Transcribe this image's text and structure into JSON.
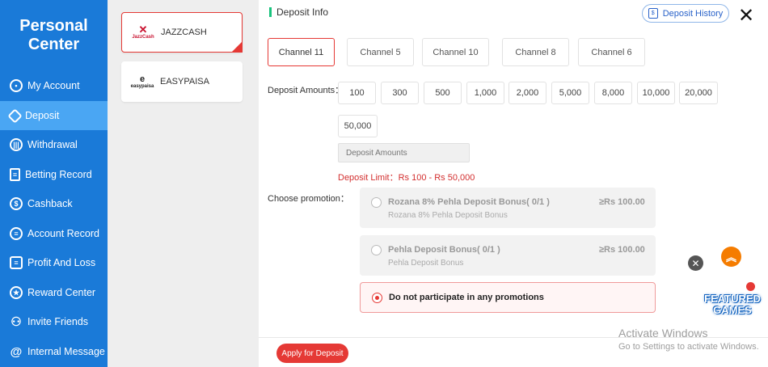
{
  "sidebar": {
    "title_line1": "Personal",
    "title_line2": "Center",
    "items": [
      {
        "label": "My Account",
        "icon": "person-circle-icon"
      },
      {
        "label": "Deposit",
        "icon": "deposit-tag-icon"
      },
      {
        "label": "Withdrawal",
        "icon": "bar-chart-icon"
      },
      {
        "label": "Betting Record",
        "icon": "clipboard-icon"
      },
      {
        "label": "Cashback",
        "icon": "coins-icon"
      },
      {
        "label": "Account Record",
        "icon": "account-record-icon"
      },
      {
        "label": "Profit And Loss",
        "icon": "profit-icon"
      },
      {
        "label": "Reward Center",
        "icon": "reward-icon"
      },
      {
        "label": "Invite Friends",
        "icon": "invite-friends-icon"
      },
      {
        "label": "Internal Message",
        "icon": "at-sign-icon"
      }
    ],
    "active_index": 1
  },
  "payment_methods": [
    {
      "label": "JAZZCASH",
      "logo_text": "JazzCash",
      "icon": "jazzcash-logo"
    },
    {
      "label": "EASYPAISA",
      "logo_text": "easypaisa",
      "icon": "easypaisa-logo"
    }
  ],
  "header": {
    "title": "Deposit Info",
    "history_label": "Deposit History",
    "close_glyph": "✕"
  },
  "channels": [
    "Channel 11",
    "Channel 5",
    "Channel 10",
    "Channel 8",
    "Channel 6"
  ],
  "amounts": {
    "label": "Deposit Amounts：",
    "options": [
      "100",
      "300",
      "500",
      "1,000",
      "2,000",
      "5,000",
      "8,000",
      "10,000",
      "20,000",
      "50,000"
    ],
    "input_placeholder": "Deposit Amounts",
    "limit_text": "Deposit Limit：Rs  100  - Rs  50,000"
  },
  "promotion": {
    "label": "Choose promotion：",
    "options": [
      {
        "title": "Rozana 8% Pehla Deposit Bonus( 0/1 )",
        "subtitle": "Rozana 8% Pehla Deposit Bonus",
        "amount": "≥Rs  100.00"
      },
      {
        "title": "Pehla Deposit Bonus( 0/1 )",
        "subtitle": "Pehla Deposit Bonus",
        "amount": "≥Rs  100.00"
      }
    ],
    "none_label": "Do not participate in any promotions"
  },
  "apply_label": "Apply for Deposit",
  "featured": {
    "line1": "FEATURED",
    "line2": "GAMES"
  },
  "watermark": {
    "line1": "Activate Windows",
    "line2": "Go to Settings to activate Windows."
  },
  "colors": {
    "sidebar": "#1a7ad8",
    "sidebar_active": "#4aa6f3",
    "accent_red": "#e53935",
    "green": "#19c37d"
  }
}
